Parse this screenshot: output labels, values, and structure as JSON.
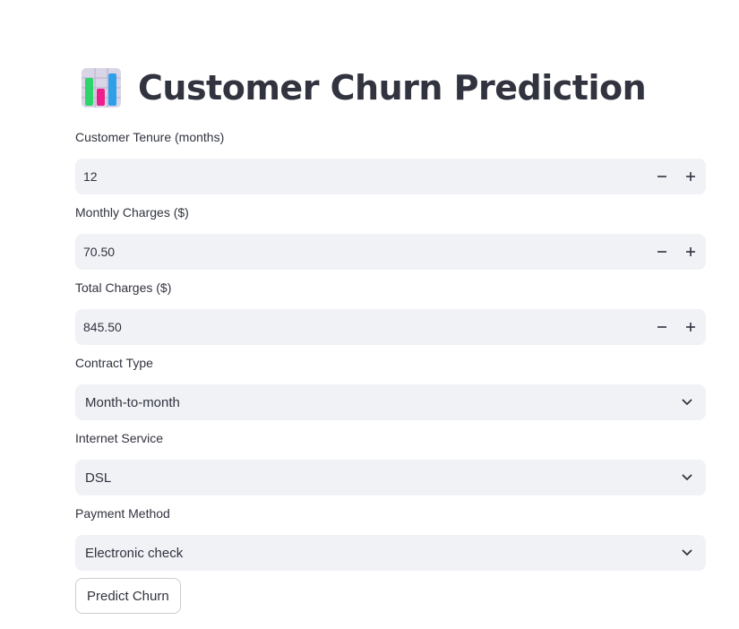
{
  "page": {
    "title": "Customer Churn Prediction",
    "title_emoji": "bar-chart-icon"
  },
  "fields": {
    "tenure": {
      "label": "Customer Tenure (months)",
      "value": "12"
    },
    "monthly_charges": {
      "label": "Monthly Charges ($)",
      "value": "70.50"
    },
    "total_charges": {
      "label": "Total Charges ($)",
      "value": "845.50"
    },
    "contract_type": {
      "label": "Contract Type",
      "selected": "Month-to-month"
    },
    "internet_service": {
      "label": "Internet Service",
      "selected": "DSL"
    },
    "payment_method": {
      "label": "Payment Method",
      "selected": "Electronic check"
    }
  },
  "actions": {
    "predict_label": "Predict Churn"
  },
  "colors": {
    "text": "#31333f",
    "input_bg": "#f0f2f6",
    "button_border": "#c9cacf",
    "page_bg": "#ffffff"
  }
}
